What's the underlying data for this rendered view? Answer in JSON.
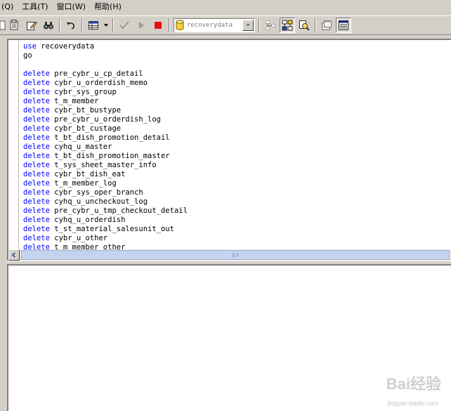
{
  "menubar": {
    "items": [
      {
        "label": "(Q)"
      },
      {
        "label": "工具(T)"
      },
      {
        "label": "窗口(W)"
      },
      {
        "label": "帮助(H)"
      }
    ]
  },
  "toolbar": {
    "database": {
      "selected": "recoverydata",
      "icon": "database-cylinder-icon"
    },
    "icons": [
      "new-query-icon",
      "open-file-icon",
      "edit-icon",
      "find-icon",
      "undo-icon",
      "grid-results-icon",
      "dropdown-arrow-icon",
      "parse-check-icon",
      "execute-icon",
      "stop-icon",
      "object-browser-icon",
      "show-plan-icon",
      "index-tuning-icon",
      "properties-icon",
      "results-pane-icon"
    ],
    "colors": {
      "stop": "#e81010",
      "check": "#808080",
      "execute": "#808080"
    }
  },
  "editor": {
    "lines": [
      {
        "kw": "use",
        "text": " recoverydata"
      },
      {
        "kw": "",
        "text": "go"
      },
      {
        "kw": "",
        "text": ""
      },
      {
        "kw": "delete",
        "text": " pre_cybr_u_cp_detail"
      },
      {
        "kw": "delete",
        "text": " cybr_u_orderdish_memo"
      },
      {
        "kw": "delete",
        "text": " cybr_sys_group"
      },
      {
        "kw": "delete",
        "text": " t_m_member"
      },
      {
        "kw": "delete",
        "text": " cybr_bt_bustype"
      },
      {
        "kw": "delete",
        "text": " pre_cybr_u_orderdish_log"
      },
      {
        "kw": "delete",
        "text": " cybr_bt_custage"
      },
      {
        "kw": "delete",
        "text": " t_bt_dish_promotion_detail"
      },
      {
        "kw": "delete",
        "text": " cyhq_u_master"
      },
      {
        "kw": "delete",
        "text": " t_bt_dish_promotion_master"
      },
      {
        "kw": "delete",
        "text": " t_sys_sheet_master_info"
      },
      {
        "kw": "delete",
        "text": " cybr_bt_dish_eat"
      },
      {
        "kw": "delete",
        "text": " t_m_member_log"
      },
      {
        "kw": "delete",
        "text": " cybr_sys_oper_branch"
      },
      {
        "kw": "delete",
        "text": " cyhq_u_uncheckout_log"
      },
      {
        "kw": "delete",
        "text": " pre_cybr_u_tmp_checkout_detail"
      },
      {
        "kw": "delete",
        "text": " cyhq_u_orderdish"
      },
      {
        "kw": "delete",
        "text": " t_st_material_salesunit_out"
      },
      {
        "kw": "delete",
        "text": " cybr_u_other"
      },
      {
        "kw": "delete",
        "text": " t_m_member_other"
      }
    ],
    "keyword_color": "#0000ff"
  },
  "watermark": {
    "logo": "Bai经验",
    "url": "jingyan.baidu.com"
  }
}
